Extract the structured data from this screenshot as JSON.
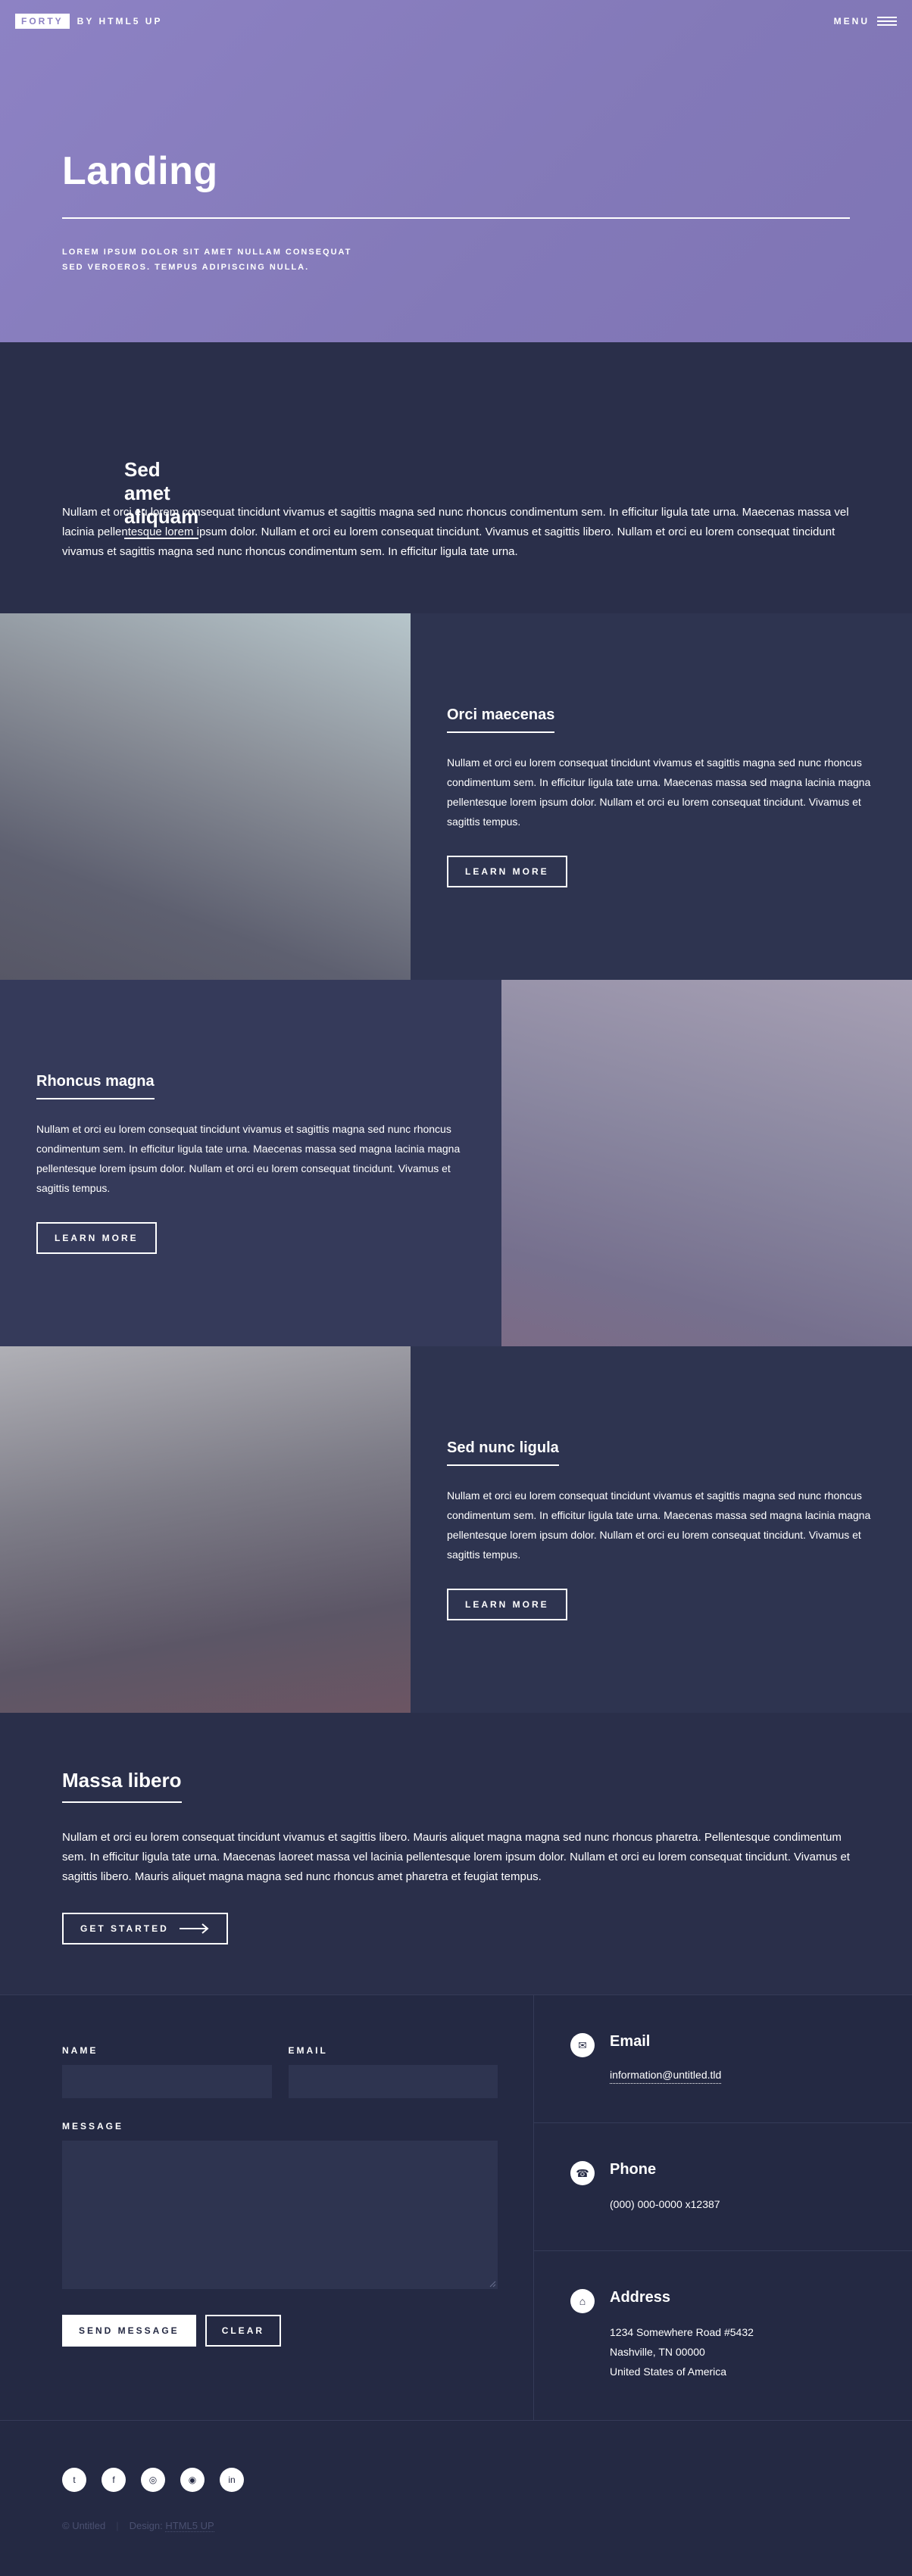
{
  "header": {
    "logo_main": "FORTY",
    "logo_by": "BY HTML5 UP",
    "menu_label": "MENU"
  },
  "banner": {
    "title": "Landing",
    "subtitle_line1": "LOREM IPSUM DOLOR SIT AMET NULLAM CONSEQUAT",
    "subtitle_line2": "SED VEROEROS. TEMPUS ADIPISCING NULLA."
  },
  "intro": {
    "title": "Sed amet aliquam",
    "text": "Nullam et orci eu lorem consequat tincidunt vivamus et sagittis magna sed nunc rhoncus condimentum sem. In efficitur ligula tate urna. Maecenas massa vel lacinia pellentesque lorem ipsum dolor. Nullam et orci eu lorem consequat tincidunt. Vivamus et sagittis libero. Nullam et orci eu lorem consequat tincidunt vivamus et sagittis magna sed nunc rhoncus condimentum sem. In efficitur ligula tate urna."
  },
  "spotlights": [
    {
      "title": "Orci maecenas",
      "text": "Nullam et orci eu lorem consequat tincidunt vivamus et sagittis magna sed nunc rhoncus condimentum sem. In efficitur ligula tate urna. Maecenas massa sed magna lacinia magna pellentesque lorem ipsum dolor. Nullam et orci eu lorem consequat tincidunt. Vivamus et sagittis tempus.",
      "button": "LEARN MORE"
    },
    {
      "title": "Rhoncus magna",
      "text": "Nullam et orci eu lorem consequat tincidunt vivamus et sagittis magna sed nunc rhoncus condimentum sem. In efficitur ligula tate urna. Maecenas massa sed magna lacinia magna pellentesque lorem ipsum dolor. Nullam et orci eu lorem consequat tincidunt. Vivamus et sagittis tempus.",
      "button": "LEARN MORE"
    },
    {
      "title": "Sed nunc ligula",
      "text": "Nullam et orci eu lorem consequat tincidunt vivamus et sagittis magna sed nunc rhoncus condimentum sem. In efficitur ligula tate urna. Maecenas massa sed magna lacinia magna pellentesque lorem ipsum dolor. Nullam et orci eu lorem consequat tincidunt. Vivamus et sagittis tempus.",
      "button": "LEARN MORE"
    }
  ],
  "massa": {
    "title": "Massa libero",
    "text": "Nullam et orci eu lorem consequat tincidunt vivamus et sagittis libero. Mauris aliquet magna magna sed nunc rhoncus pharetra. Pellentesque condimentum sem. In efficitur ligula tate urna. Maecenas laoreet massa vel lacinia pellentesque lorem ipsum dolor. Nullam et orci eu lorem consequat tincidunt. Vivamus et sagittis libero. Mauris aliquet magna magna sed nunc rhoncus amet pharetra et feugiat tempus.",
    "button": "GET STARTED"
  },
  "form": {
    "name_label": "NAME",
    "email_label": "EMAIL",
    "message_label": "MESSAGE",
    "send_button": "SEND MESSAGE",
    "clear_button": "CLEAR"
  },
  "contact_info": {
    "email_title": "Email",
    "email_value": "information@untitled.tld",
    "phone_title": "Phone",
    "phone_value": "(000) 000-0000 x12387",
    "address_title": "Address",
    "address_line1": "1234 Somewhere Road #5432",
    "address_line2": "Nashville, TN 00000",
    "address_line3": "United States of America"
  },
  "footer": {
    "social_icons": [
      "twitter-icon",
      "facebook-icon",
      "instagram-icon",
      "github-icon",
      "linkedin-icon"
    ],
    "copyright": "© Untitled",
    "design_label": "Design:",
    "design_link": "HTML5 UP"
  },
  "colors": {
    "banner": "#8d82c4",
    "dark_bg": "#242943",
    "section_bg": "#2a2f4a",
    "spot_bg": "#2e3450"
  }
}
